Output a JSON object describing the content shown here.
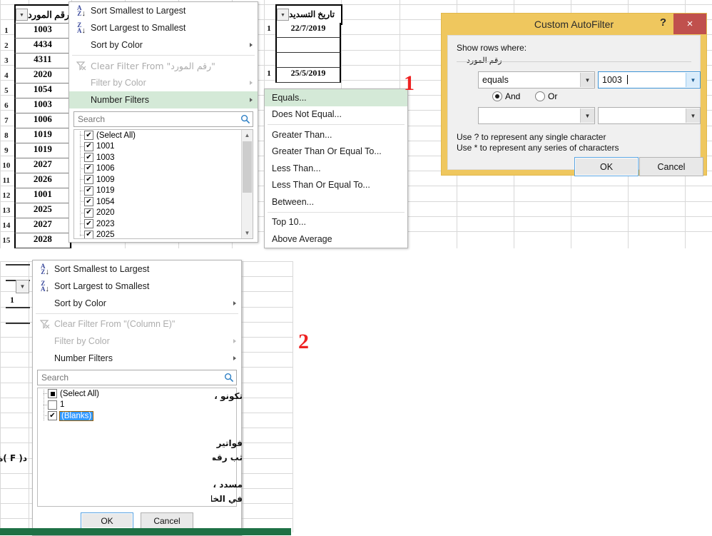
{
  "sheet": {
    "supplier_column": {
      "header": "رقم المورد",
      "rows": [
        {
          "num": "1",
          "value": "1003"
        },
        {
          "num": "2",
          "value": "4434"
        },
        {
          "num": "3",
          "value": "4311"
        },
        {
          "num": "4",
          "value": "2020"
        },
        {
          "num": "5",
          "value": "1054"
        },
        {
          "num": "6",
          "value": "1003"
        },
        {
          "num": "7",
          "value": "1006"
        },
        {
          "num": "8",
          "value": "1019"
        },
        {
          "num": "9",
          "value": "1019"
        },
        {
          "num": "10",
          "value": "2027"
        },
        {
          "num": "11",
          "value": "2026"
        },
        {
          "num": "12",
          "value": "1001"
        },
        {
          "num": "13",
          "value": "2025"
        },
        {
          "num": "14",
          "value": "2027"
        },
        {
          "num": "15",
          "value": "2028"
        }
      ]
    },
    "date_column": {
      "header": "تاريخ التسديد",
      "rows": [
        {
          "label": "1",
          "value": "22/7/2019"
        },
        {
          "label": "",
          "value": ""
        },
        {
          "label": "",
          "value": ""
        },
        {
          "label": "1",
          "value": "25/5/2019"
        }
      ]
    },
    "fragments": [
      {
        "text": "تكونو ،"
      },
      {
        "text": "فواتير"
      },
      {
        "text": "ثب رقم"
      },
      {
        "text": "مسدد ،"
      },
      {
        "text": "في الخا"
      },
      {
        "text": "د( F )ة"
      },
      {
        "text": "1"
      }
    ]
  },
  "menu1": {
    "items": [
      {
        "label": "Sort Smallest to Largest",
        "icon": "sort-ascending-icon",
        "enabled": true,
        "submenu": false,
        "highlight": false
      },
      {
        "label": "Sort Largest to Smallest",
        "icon": "sort-descending-icon",
        "enabled": true,
        "submenu": false,
        "highlight": false
      },
      {
        "label": "Sort by Color",
        "icon": "none",
        "enabled": true,
        "submenu": true,
        "highlight": false
      },
      {
        "label": "Clear Filter From \"رقم المورد\"",
        "icon": "clear-filter-icon",
        "enabled": false,
        "submenu": false,
        "highlight": false
      },
      {
        "label": "Filter by Color",
        "icon": "none",
        "enabled": false,
        "submenu": true,
        "highlight": false
      },
      {
        "label": "Number Filters",
        "icon": "none",
        "enabled": true,
        "submenu": true,
        "highlight": true
      }
    ],
    "search_placeholder": "Search",
    "search_value": "",
    "list": [
      {
        "label": "(Select All)",
        "state": "checked"
      },
      {
        "label": "1001",
        "state": "checked"
      },
      {
        "label": "1003",
        "state": "checked"
      },
      {
        "label": "1006",
        "state": "checked"
      },
      {
        "label": "1009",
        "state": "checked"
      },
      {
        "label": "1019",
        "state": "checked"
      },
      {
        "label": "1054",
        "state": "checked"
      },
      {
        "label": "2020",
        "state": "checked"
      },
      {
        "label": "2023",
        "state": "checked"
      },
      {
        "label": "2025",
        "state": "checked"
      }
    ]
  },
  "submenu": {
    "items": [
      {
        "label": "Equals...",
        "highlight": true,
        "sep_after": false
      },
      {
        "label": "Does Not Equal...",
        "highlight": false,
        "sep_after": true
      },
      {
        "label": "Greater Than...",
        "highlight": false,
        "sep_after": false
      },
      {
        "label": "Greater Than Or Equal To...",
        "highlight": false,
        "sep_after": false
      },
      {
        "label": "Less Than...",
        "highlight": false,
        "sep_after": false
      },
      {
        "label": "Less Than Or Equal To...",
        "highlight": false,
        "sep_after": false
      },
      {
        "label": "Between...",
        "highlight": false,
        "sep_after": true
      },
      {
        "label": "Top 10...",
        "highlight": false,
        "sep_after": false
      },
      {
        "label": "Above Average",
        "highlight": false,
        "sep_after": false
      }
    ]
  },
  "dialog": {
    "title": "Custom AutoFilter",
    "help_label": "?",
    "close_label": "×",
    "show_rows_label": "Show rows where:",
    "field_label": "رقم المورد",
    "operator1": "equals",
    "value1": "1003",
    "operator2": "",
    "value2": "",
    "and_label": "And",
    "or_label": "Or",
    "and_selected": true,
    "hint1": "Use ? to represent any single character",
    "hint2": "Use * to represent any series of characters",
    "ok_label": "OK",
    "cancel_label": "Cancel"
  },
  "menu2": {
    "items": [
      {
        "label": "Sort Smallest to Largest",
        "icon": "sort-ascending-icon",
        "enabled": true,
        "submenu": false
      },
      {
        "label": "Sort Largest to Smallest",
        "icon": "sort-descending-icon",
        "enabled": true,
        "submenu": false
      },
      {
        "label": "Sort by Color",
        "icon": "none",
        "enabled": true,
        "submenu": true
      },
      {
        "label": "Clear Filter From \"(Column E)\"",
        "icon": "clear-filter-icon",
        "enabled": false,
        "submenu": false
      },
      {
        "label": "Filter by Color",
        "icon": "none",
        "enabled": false,
        "submenu": true
      },
      {
        "label": "Number Filters",
        "icon": "none",
        "enabled": true,
        "submenu": true
      }
    ],
    "search_placeholder": "Search",
    "search_value": "",
    "list": [
      {
        "label": "(Select All)",
        "state": "partial"
      },
      {
        "label": "1",
        "state": "unchecked"
      },
      {
        "label": "(Blanks)",
        "state": "checked",
        "selected": true
      }
    ],
    "ok_label": "OK",
    "cancel_label": "Cancel"
  },
  "callouts": [
    {
      "text": "1"
    },
    {
      "text": "2"
    }
  ],
  "colors": {
    "dialog_frame": "#efc75e",
    "close_button": "#c0504d",
    "menu_highlight": "#d4e9d7",
    "selection_blue": "#3399ff",
    "callout_red": "#ee2222",
    "accent_green": "#1e7145"
  }
}
